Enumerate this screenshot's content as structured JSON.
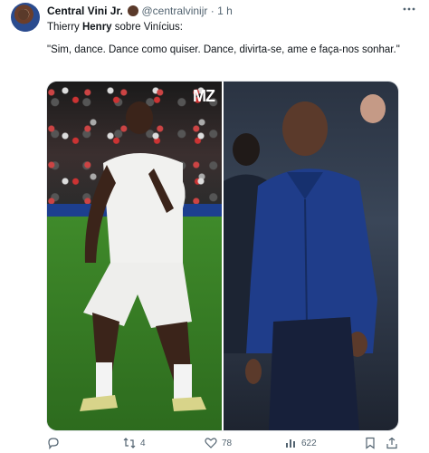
{
  "tweet": {
    "author_name": "Central Vini Jr.",
    "handle": "@centralvinijr",
    "separator": "·",
    "time": "1 h",
    "line1_prefix": "Thierry ",
    "line1_bold": "Henry",
    "line1_suffix": " sobre Vinícius:",
    "quote": "\"Sim, dance. Dance como quiser. Dance, divirta-se, ame e faça-nos sonhar.\""
  },
  "media": {
    "watermark": "MZ"
  },
  "actions": {
    "retweets": "4",
    "likes": "78",
    "views": "622"
  },
  "icons": {
    "more": "more-icon",
    "reply": "reply-icon",
    "retweet": "retweet-icon",
    "like": "heart-icon",
    "views": "views-icon",
    "bookmark": "bookmark-icon",
    "share": "share-icon"
  },
  "colors": {
    "text": "#0f1419",
    "muted": "#536471",
    "background": "#ffffff"
  }
}
